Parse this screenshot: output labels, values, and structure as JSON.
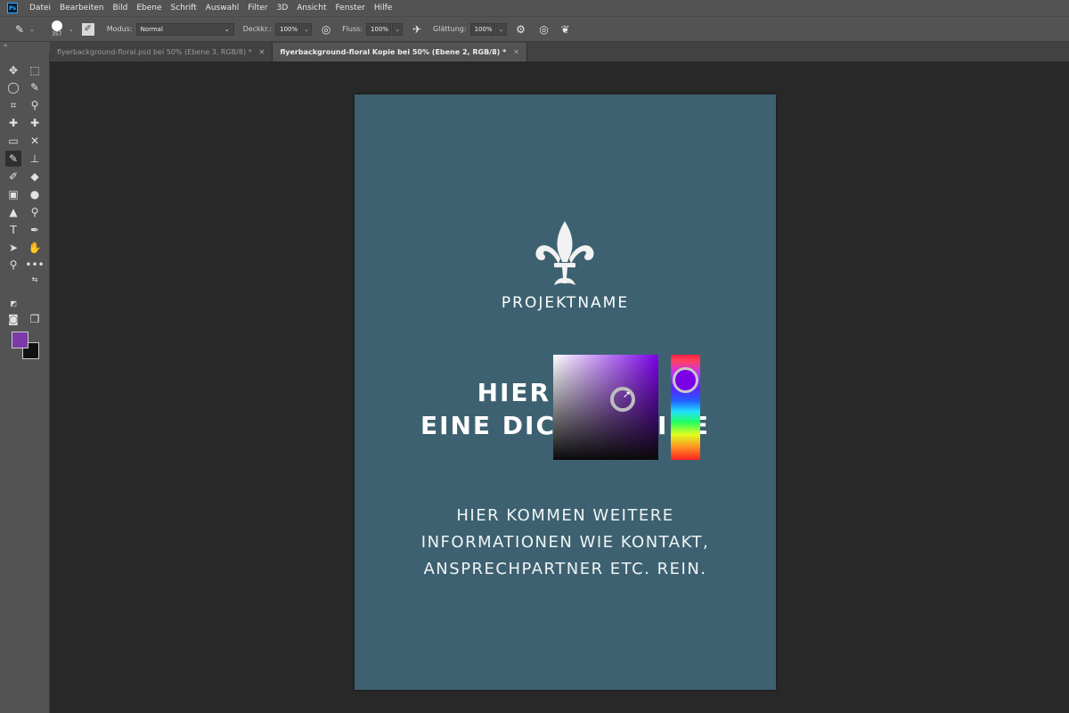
{
  "app": {
    "logo": "Ps"
  },
  "menu": [
    "Datei",
    "Bearbeiten",
    "Bild",
    "Ebene",
    "Schrift",
    "Auswahl",
    "Filter",
    "3D",
    "Ansicht",
    "Fenster",
    "Hilfe"
  ],
  "options": {
    "brush_size": "357",
    "mode_label": "Modus:",
    "mode_value": "Normal",
    "opacity_label": "Deckkr.:",
    "opacity_value": "100%",
    "flow_label": "Fluss:",
    "flow_value": "100%",
    "smoothing_label": "Glättung:",
    "smoothing_value": "100%"
  },
  "tabs": [
    {
      "label": "flyerbackground-floral.psd bei 50% (Ebene 3, RGB/8) *",
      "active": false
    },
    {
      "label": "flyerbackground-floral Kopie bei 50% (Ebene 2, RGB/8) *",
      "active": true
    }
  ],
  "colors": {
    "foreground": "#7b3aa8",
    "background": "#111111",
    "flyer_bg": "#3d6170",
    "hud_hue": "#7a00e6"
  },
  "flyer": {
    "project_name": "PROJEKTNAME",
    "headline_line1": "HIER K     T",
    "headline_line2": "EINE DICK      LINE",
    "info_line1": "HIER KOMMEN WEITERE",
    "info_line2": "INFORMATIONEN WIE KONTAKT,",
    "info_line3": "ANSPRECHPARTNER ETC. REIN."
  },
  "tools": [
    "move-tool",
    "marquee-tool",
    "lasso-tool",
    "quick-select-tool",
    "crop-tool",
    "eyedropper-tool",
    "healing-tool",
    "patch-tool",
    "frame-tool",
    "content-aware-move-tool",
    "brush-tool",
    "stamp-tool",
    "history-brush-tool",
    "eraser-tool",
    "gradient-tool",
    "blur-tool",
    "dodge-tool",
    "sharpen-tool",
    "type-tool",
    "pen-tool",
    "path-select-tool",
    "hand-tool",
    "zoom-tool",
    "more-tools"
  ]
}
